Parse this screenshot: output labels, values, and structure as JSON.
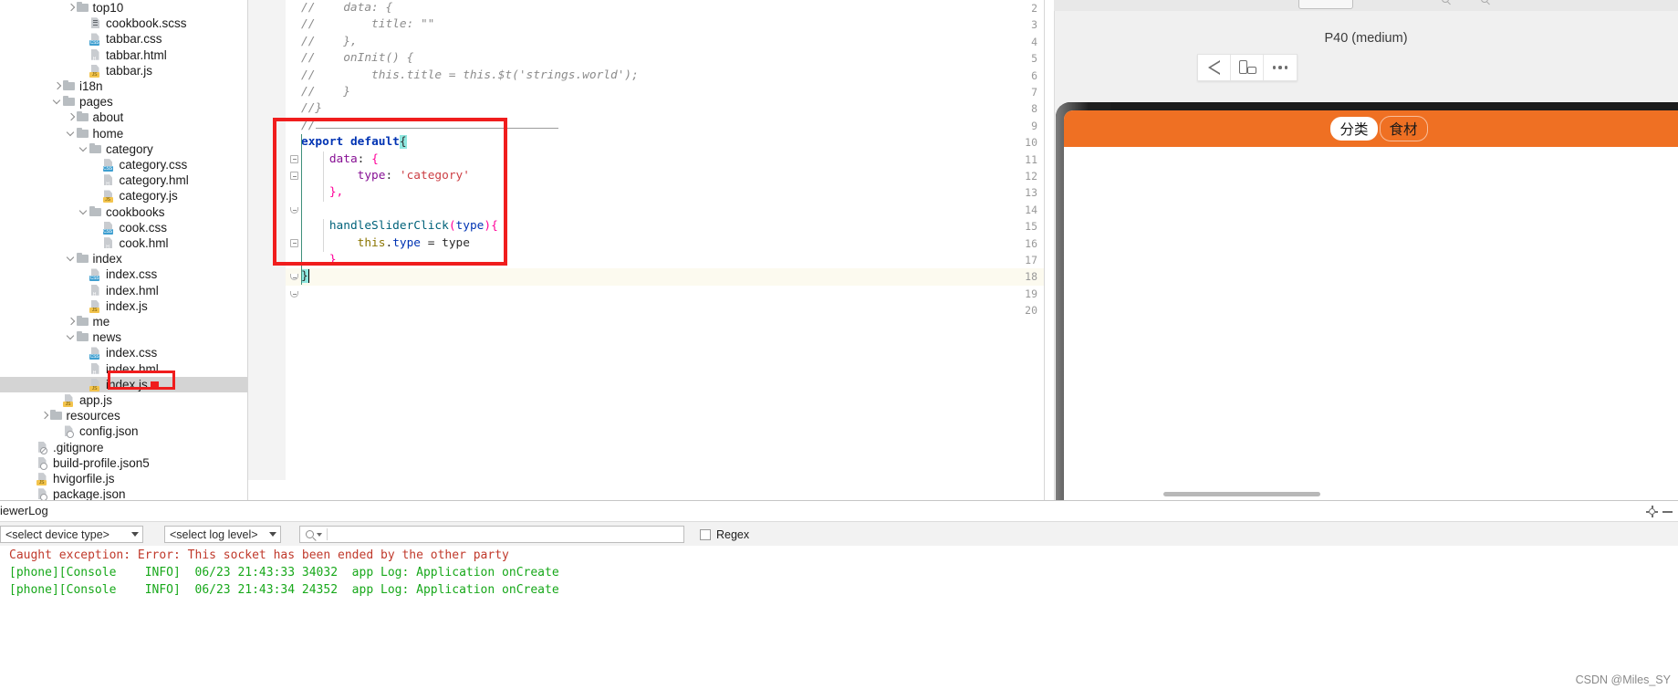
{
  "project_tree": {
    "rows": [
      {
        "indent": 5,
        "arrow": "right",
        "icon": "folder",
        "label": "top10"
      },
      {
        "indent": 6,
        "arrow": "none",
        "icon": "scss",
        "label": "cookbook.scss"
      },
      {
        "indent": 6,
        "arrow": "none",
        "icon": "css",
        "label": "tabbar.css"
      },
      {
        "indent": 6,
        "arrow": "none",
        "icon": "html",
        "label": "tabbar.html"
      },
      {
        "indent": 6,
        "arrow": "none",
        "icon": "js",
        "label": "tabbar.js"
      },
      {
        "indent": 4,
        "arrow": "right",
        "icon": "folder",
        "label": "i18n"
      },
      {
        "indent": 4,
        "arrow": "down",
        "icon": "folder",
        "label": "pages"
      },
      {
        "indent": 5,
        "arrow": "right",
        "icon": "folder",
        "label": "about"
      },
      {
        "indent": 5,
        "arrow": "down",
        "icon": "folder",
        "label": "home"
      },
      {
        "indent": 6,
        "arrow": "down",
        "icon": "folder",
        "label": "category"
      },
      {
        "indent": 7,
        "arrow": "none",
        "icon": "css",
        "label": "category.css"
      },
      {
        "indent": 7,
        "arrow": "none",
        "icon": "html",
        "label": "category.hml"
      },
      {
        "indent": 7,
        "arrow": "none",
        "icon": "js",
        "label": "category.js"
      },
      {
        "indent": 6,
        "arrow": "down",
        "icon": "folder",
        "label": "cookbooks"
      },
      {
        "indent": 7,
        "arrow": "none",
        "icon": "css",
        "label": "cook.css"
      },
      {
        "indent": 7,
        "arrow": "none",
        "icon": "html",
        "label": "cook.hml"
      },
      {
        "indent": 5,
        "arrow": "down",
        "icon": "folder",
        "label": "index"
      },
      {
        "indent": 6,
        "arrow": "none",
        "icon": "css",
        "label": "index.css"
      },
      {
        "indent": 6,
        "arrow": "none",
        "icon": "html",
        "label": "index.hml"
      },
      {
        "indent": 6,
        "arrow": "none",
        "icon": "js",
        "label": "index.js"
      },
      {
        "indent": 5,
        "arrow": "right",
        "icon": "folder",
        "label": "me"
      },
      {
        "indent": 5,
        "arrow": "down",
        "icon": "folder",
        "label": "news"
      },
      {
        "indent": 6,
        "arrow": "none",
        "icon": "css",
        "label": "index.css"
      },
      {
        "indent": 6,
        "arrow": "none",
        "icon": "html",
        "label": "index.hml"
      },
      {
        "indent": 6,
        "arrow": "none",
        "icon": "js",
        "label": "index.js",
        "selected": true,
        "highlighted": true
      },
      {
        "indent": 4,
        "arrow": "none",
        "icon": "js",
        "label": "app.js"
      },
      {
        "indent": 3,
        "arrow": "right",
        "icon": "folder",
        "label": "resources"
      },
      {
        "indent": 4,
        "arrow": "none",
        "icon": "json",
        "label": "config.json"
      },
      {
        "indent": 2,
        "arrow": "none",
        "icon": "git",
        "label": ".gitignore"
      },
      {
        "indent": 2,
        "arrow": "none",
        "icon": "json",
        "label": "build-profile.json5"
      },
      {
        "indent": 2,
        "arrow": "none",
        "icon": "js",
        "label": "hvigorfile.js"
      },
      {
        "indent": 2,
        "arrow": "none",
        "icon": "json",
        "label": "package.json"
      }
    ]
  },
  "editor": {
    "lines": [
      {
        "num": "2",
        "text": "//    data: {",
        "style": "comment"
      },
      {
        "num": "3",
        "text": "//        title: \"\"",
        "style": "comment"
      },
      {
        "num": "4",
        "text": "//    },",
        "style": "comment"
      },
      {
        "num": "5",
        "text": "//    onInit() {",
        "style": "comment"
      },
      {
        "num": "6",
        "text": "//        this.title = this.$t('strings.world');",
        "style": "comment"
      },
      {
        "num": "7",
        "text": "//    }",
        "style": "comment"
      },
      {
        "num": "8",
        "text": "//}",
        "style": "comment"
      },
      {
        "num": "9",
        "text": "//",
        "style": "comment-sep"
      },
      {
        "num": "10",
        "text": "export default{",
        "style": "code"
      },
      {
        "num": "11",
        "text": "    data: {",
        "style": "code"
      },
      {
        "num": "12",
        "text": "        type: 'category'",
        "style": "code"
      },
      {
        "num": "13",
        "text": "    },",
        "style": "code"
      },
      {
        "num": "14",
        "text": "",
        "style": "code"
      },
      {
        "num": "15",
        "text": "    handleSliderClick(type){",
        "style": "code"
      },
      {
        "num": "16",
        "text": "        this.type = type",
        "style": "code"
      },
      {
        "num": "17",
        "text": "    }",
        "style": "code"
      },
      {
        "num": "18",
        "text": "}",
        "style": "code",
        "current": true
      },
      {
        "num": "19",
        "text": "",
        "style": "code"
      },
      {
        "num": "20",
        "text": "",
        "style": "code"
      }
    ]
  },
  "preview": {
    "device_name": "P40 (medium)",
    "toolbar_buttons": [
      {
        "name": "play-run",
        "icon": "triangle-left-icon"
      },
      {
        "name": "rotate",
        "icon": "rotate-device-icon"
      },
      {
        "name": "more",
        "icon": "more-dots-icon"
      }
    ],
    "app": {
      "tabs": [
        {
          "label": "分类",
          "active": true
        },
        {
          "label": "食材",
          "active": false
        }
      ],
      "header_color": "#ef7023"
    }
  },
  "log_panel": {
    "title": "iewerLog",
    "device_type_select": "<select device type>",
    "log_level_select": "<select log level>",
    "search_placeholder": "",
    "regex_label": "Regex",
    "lines": [
      {
        "text": "Caught exception: Error: This socket has been ended by the other party",
        "level": "error"
      },
      {
        "text": "[phone][Console    INFO]  06/23 21:43:33 34032  app Log: Application onCreate",
        "level": "info"
      },
      {
        "text": "[phone][Console    INFO]  06/23 21:43:34 24352  app Log: Application onCreate",
        "level": "info"
      }
    ]
  },
  "watermark": "CSDN @Miles_SY"
}
